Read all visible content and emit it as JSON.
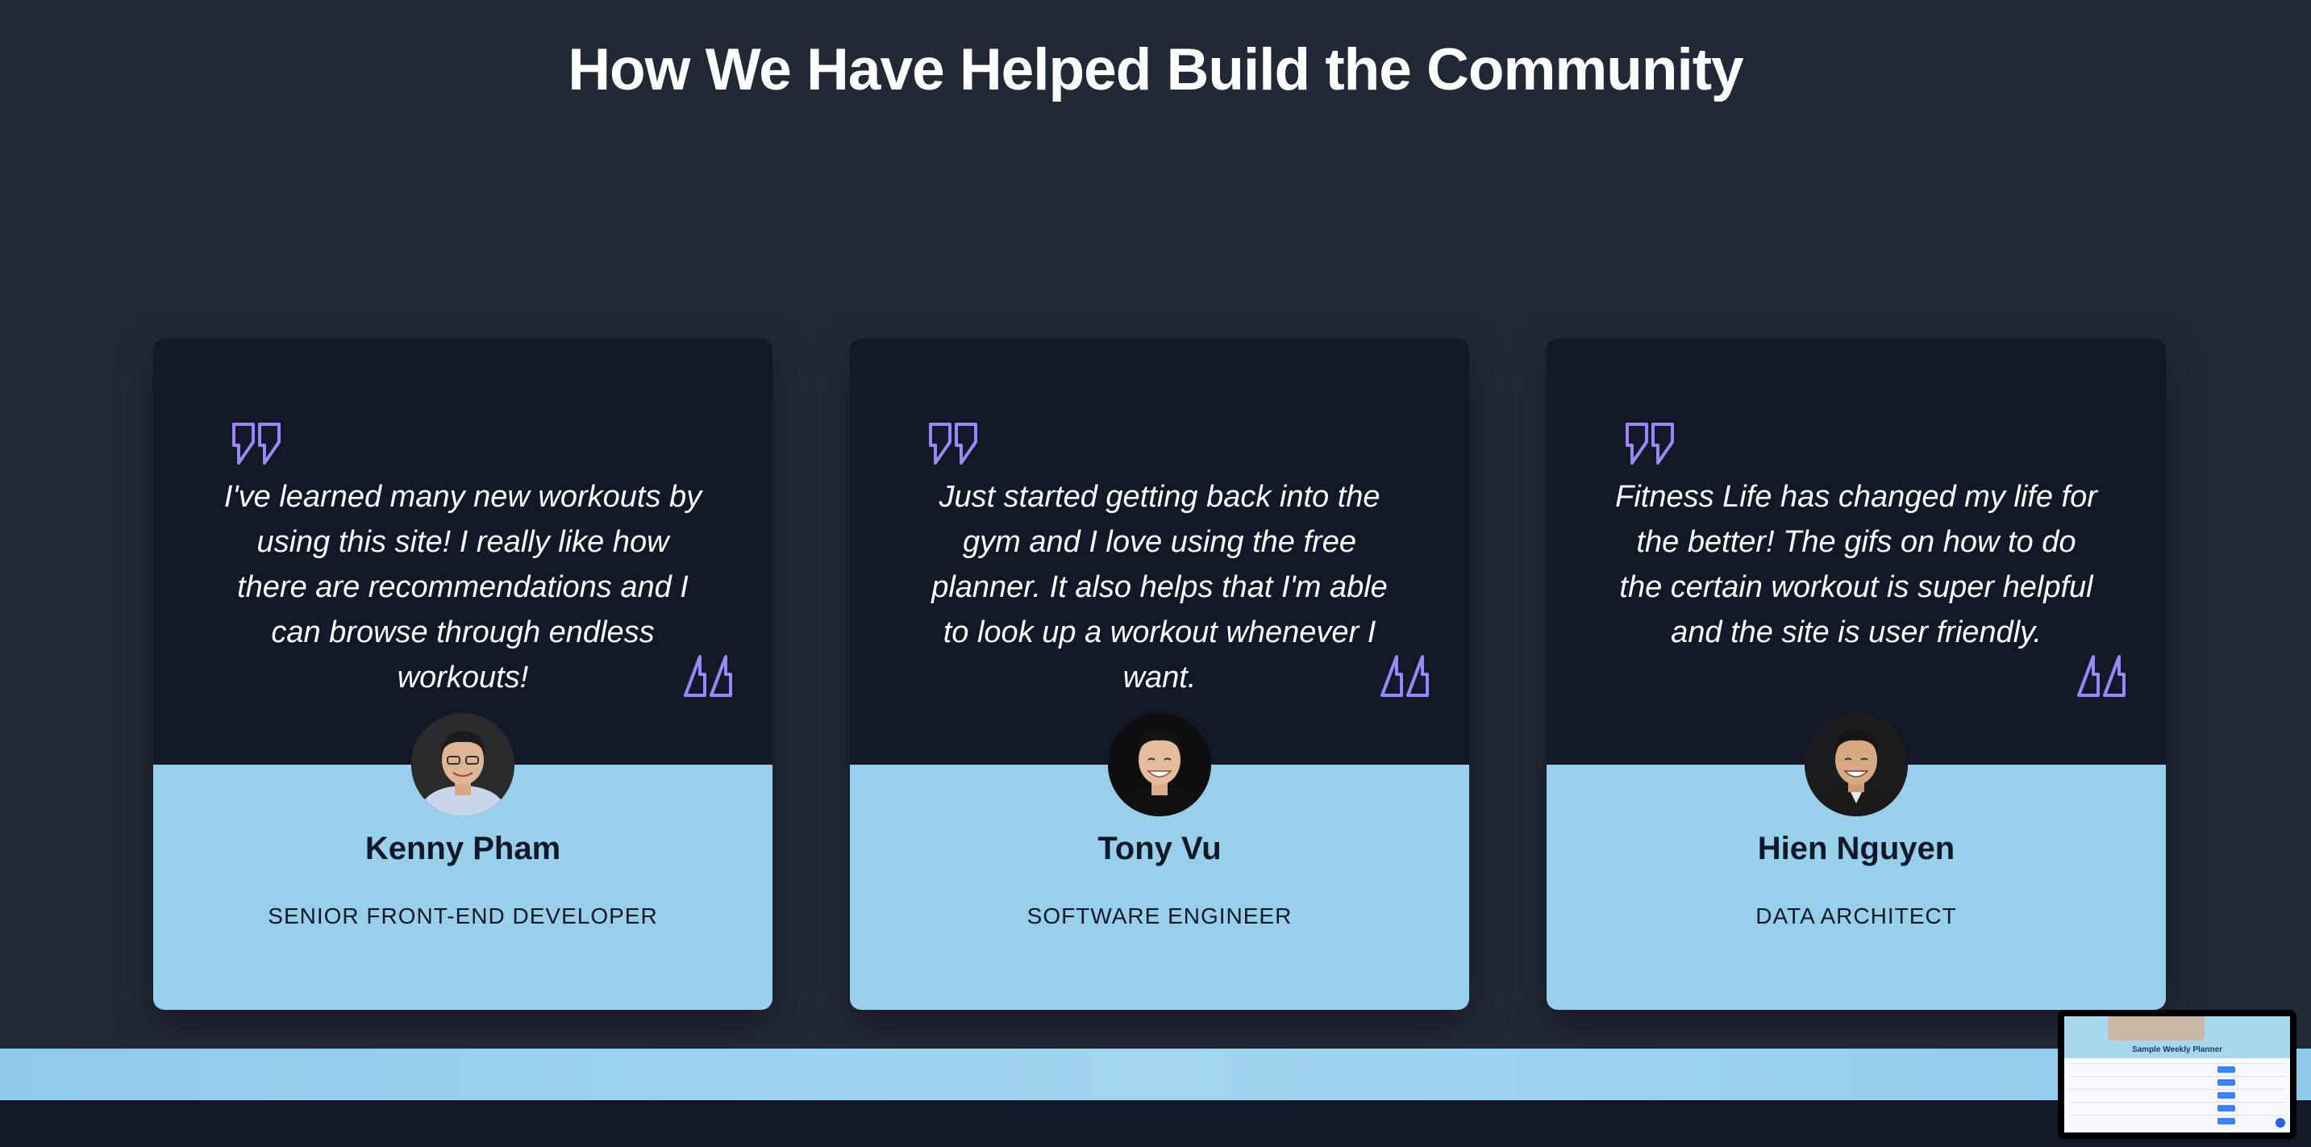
{
  "section": {
    "title": "How We Have Helped Build the Community"
  },
  "colors": {
    "page_background": "#222836",
    "card_top": "#121827",
    "card_bottom": "#98d0ec",
    "quote_icon": "#9b87f5",
    "heading_text": "#ffffff",
    "name_text": "#111827"
  },
  "testimonials": [
    {
      "quote": "I've learned many new workouts by using this site! I really like how there are recommendations and I can browse through endless workouts!",
      "name": "Kenny Pham",
      "role": "SENIOR FRONT-END DEVELOPER",
      "avatar_icon": "avatar-photo"
    },
    {
      "quote": "Just started getting back into the gym and I love using the free planner. It also helps that I'm able to look up a workout whenever I want.",
      "name": "Tony Vu",
      "role": "SOFTWARE ENGINEER",
      "avatar_icon": "avatar-photo"
    },
    {
      "quote": "Fitness Life has changed my life for the better! The gifs on how to do the certain workout is super helpful and the site is user friendly.",
      "name": "Hien Nguyen",
      "role": "DATA ARCHITECT",
      "avatar_icon": "avatar-photo"
    }
  ],
  "preview_thumbnail": {
    "title": "Sample Weekly Planner"
  }
}
